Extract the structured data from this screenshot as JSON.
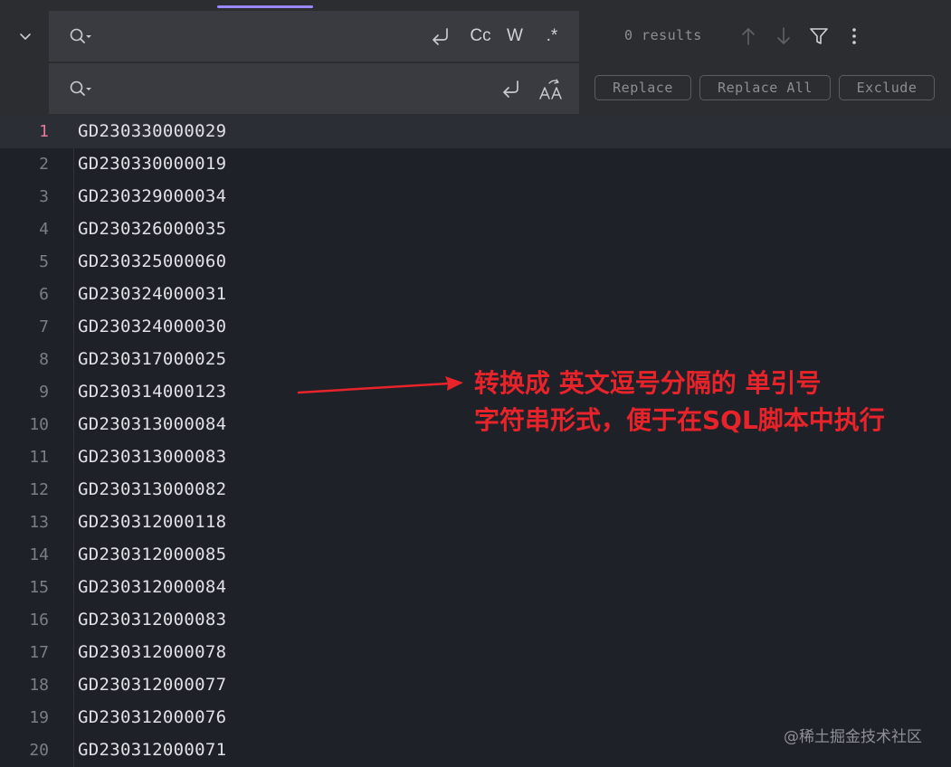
{
  "search": {
    "query": "",
    "results": "0 results",
    "options": {
      "case": "Cc",
      "word": "W",
      "regex": ".*"
    }
  },
  "replace": {
    "value": "",
    "buttons": {
      "replace": "Replace",
      "replace_all": "Replace All",
      "exclude": "Exclude"
    }
  },
  "editor": {
    "current_line": 1,
    "lines": [
      {
        "num": "1",
        "text": "GD230330000029"
      },
      {
        "num": "2",
        "text": "GD230330000019"
      },
      {
        "num": "3",
        "text": "GD230329000034"
      },
      {
        "num": "4",
        "text": "GD230326000035"
      },
      {
        "num": "5",
        "text": "GD230325000060"
      },
      {
        "num": "6",
        "text": "GD230324000031"
      },
      {
        "num": "7",
        "text": "GD230324000030"
      },
      {
        "num": "8",
        "text": "GD230317000025"
      },
      {
        "num": "9",
        "text": "GD230314000123"
      },
      {
        "num": "10",
        "text": "GD230313000084"
      },
      {
        "num": "11",
        "text": "GD230313000083"
      },
      {
        "num": "12",
        "text": "GD230313000082"
      },
      {
        "num": "13",
        "text": "GD230312000118"
      },
      {
        "num": "14",
        "text": "GD230312000085"
      },
      {
        "num": "15",
        "text": "GD230312000084"
      },
      {
        "num": "16",
        "text": "GD230312000083"
      },
      {
        "num": "17",
        "text": "GD230312000078"
      },
      {
        "num": "18",
        "text": "GD230312000077"
      },
      {
        "num": "19",
        "text": "GD230312000076"
      },
      {
        "num": "20",
        "text": "GD230312000071"
      }
    ]
  },
  "annotation": {
    "line1": "转换成 英文逗号分隔的 单引号",
    "line2": "字符串形式，便于在SQL脚本中执行",
    "color": "#e8232a"
  },
  "watermark": "@稀土掘金技术社区",
  "colors": {
    "accent": "#9b88ff",
    "current_line_number": "#e5799c",
    "background": "#1f2129",
    "toolbar": "#2b2d30"
  },
  "icons": {
    "collapse": "chevron-down-icon",
    "search": "search-history-icon",
    "newline": "newline-icon",
    "preserve_case": "preserve-case-icon",
    "prev": "arrow-up-icon",
    "next": "arrow-down-icon",
    "filter": "filter-icon",
    "more": "more-vertical-icon"
  }
}
